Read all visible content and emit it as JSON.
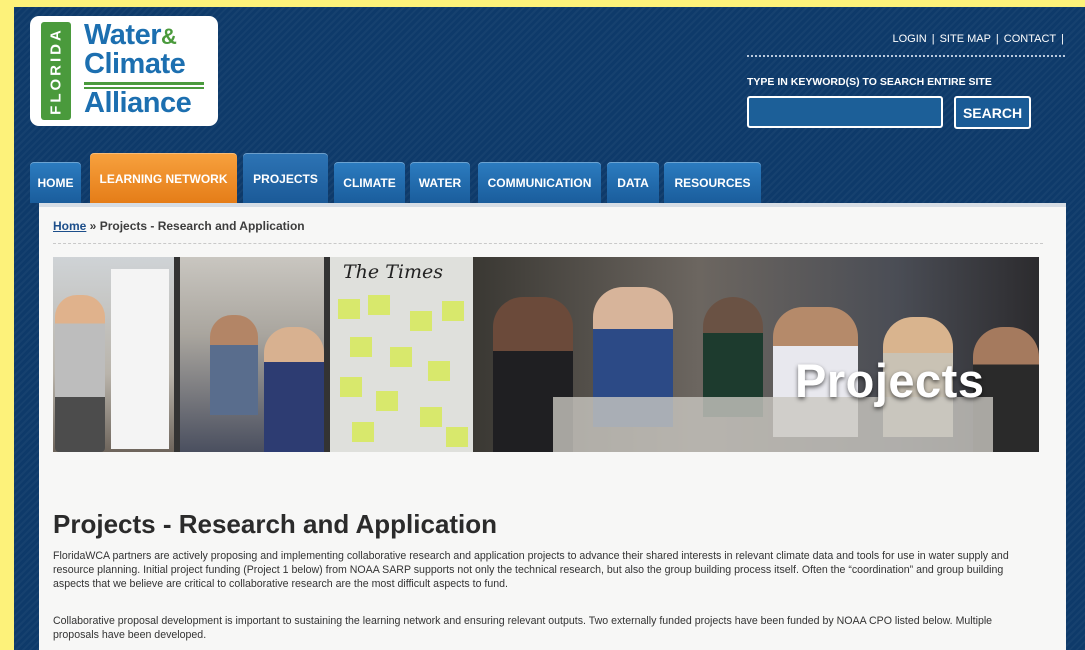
{
  "logo": {
    "vertical": "FLORIDA",
    "line1": "Water",
    "amp": "&",
    "line2": "Climate",
    "line3": "Alliance"
  },
  "toplinks": [
    "LOGIN",
    "SITE MAP",
    "CONTACT"
  ],
  "search": {
    "label": "TYPE IN KEYWORD(S) TO SEARCH ENTIRE SITE",
    "placeholder": "",
    "button": "SEARCH"
  },
  "nav": {
    "tabs": [
      "HOME",
      "LEARNING NETWORK",
      "PROJECTS",
      "CLIMATE",
      "WATER",
      "COMMUNICATION",
      "DATA",
      "RESOURCES"
    ],
    "active": "PROJECTS"
  },
  "breadcrumb": {
    "home": "Home",
    "sep": " » ",
    "current": "Projects - Research and Application"
  },
  "banner": {
    "newspaper": "The Times",
    "title": "Projects"
  },
  "main": {
    "title": "Projects - Research and Application",
    "paragraphs": [
      "FloridaWCA partners are actively proposing and implementing collaborative research and application projects to advance their shared interests in relevant climate data and tools for use in water supply and resource planning. Initial project funding (Project 1 below) from NOAA SARP supports not only the technical research, but also the group building process itself. Often the “coordination” and group building aspects that we believe are critical to collaborative research are the most difficult aspects to fund.",
      "Collaborative proposal development is important to sustaining the learning network and ensuring relevant outputs. Two externally funded projects have been funded by NOAA CPO listed below. Multiple proposals have been developed."
    ]
  },
  "colors": {
    "page_bg": "#fdf27a",
    "site_bg": "#0e3a6a",
    "tab_blue": "#2c7cc0",
    "tab_orange": "#f7a13e",
    "logo_green": "#4a9a3c",
    "logo_blue": "#1c6fb0"
  }
}
